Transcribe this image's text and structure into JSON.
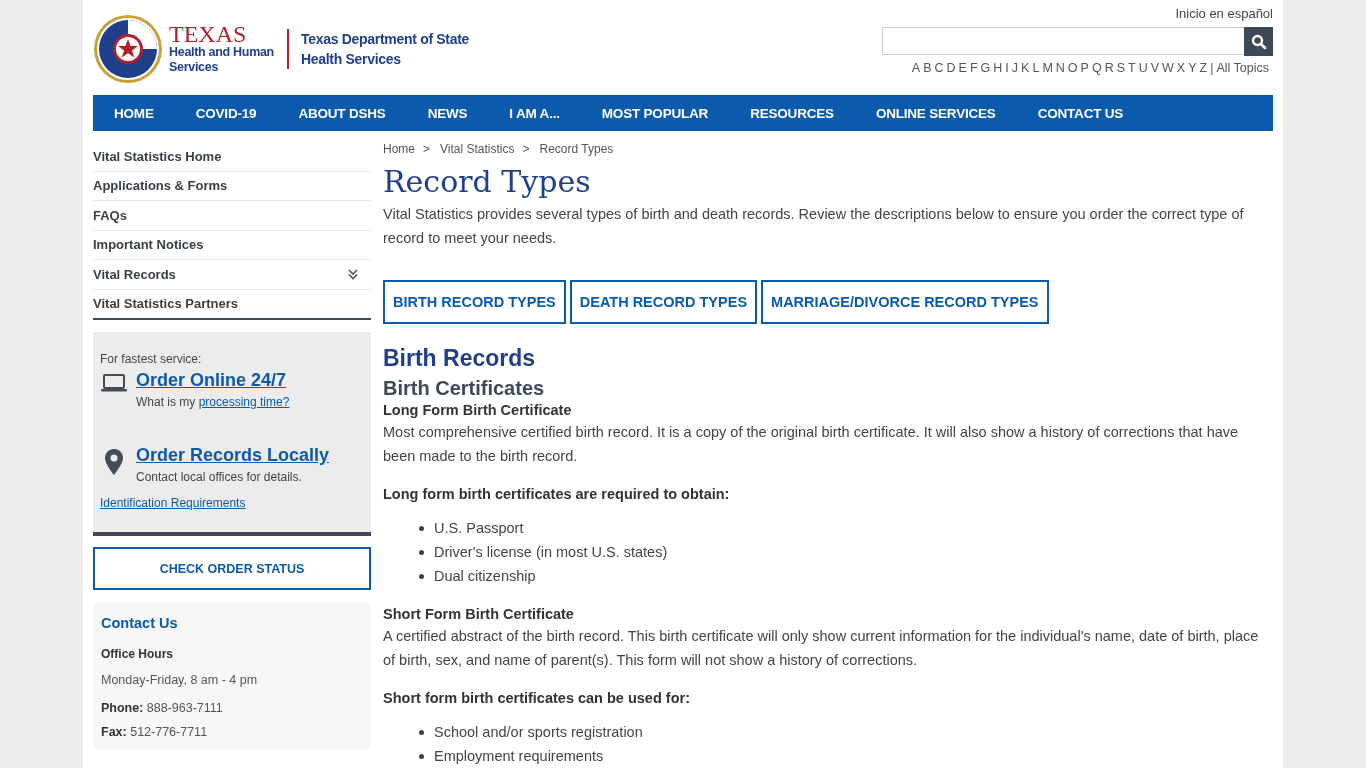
{
  "header": {
    "logo": {
      "agency": "TEXAS",
      "agency_sub": "Health and Human Services",
      "department": "Texas Department of State Health Services"
    },
    "lang_link": "Inicio en español",
    "az_letters": [
      "A",
      "B",
      "C",
      "D",
      "E",
      "F",
      "G",
      "H",
      "I",
      "J",
      "K",
      "L",
      "M",
      "N",
      "O",
      "P",
      "Q",
      "R",
      "S",
      "T",
      "U",
      "V",
      "W",
      "X",
      "Y",
      "Z"
    ],
    "az_separator": "|",
    "all_topics": "All Topics"
  },
  "nav": [
    "HOME",
    "COVID-19",
    "ABOUT DSHS",
    "NEWS",
    "I AM A...",
    "MOST POPULAR",
    "RESOURCES",
    "ONLINE SERVICES",
    "CONTACT US"
  ],
  "sidebar": {
    "items": [
      {
        "label": "Vital Statistics Home",
        "kind": "link"
      },
      {
        "label": "Applications & Forms",
        "kind": "link"
      },
      {
        "label": "FAQs",
        "kind": "link"
      },
      {
        "label": "Important Notices",
        "kind": "link"
      },
      {
        "label": "Vital Records",
        "kind": "submenu",
        "expanded": false
      },
      {
        "label": "Vital Statistics Partners",
        "kind": "link"
      }
    ],
    "order_box": {
      "intro": "For fastest service:",
      "online_link": "Order Online 24/7",
      "online_note": "What is my",
      "online_note_link": "processing time?",
      "local_link": "Order Records Locally",
      "local_note": "Contact local offices for details.",
      "id_link": "Identification Requirements"
    },
    "check_status_button": "CHECK ORDER STATUS",
    "contact": {
      "title": "Contact Us",
      "hours_label": "Office Hours",
      "hours": "Monday-Friday, 8 am - 4 pm",
      "phone_label": "Phone:",
      "phone": "888-963-7111",
      "fax_label": "Fax:",
      "fax": "512-776-7711"
    }
  },
  "main": {
    "breadcrumb": [
      "Home",
      "Vital Statistics",
      "Record Types"
    ],
    "breadcrumb_separator": ">",
    "title": "Record Types",
    "intro": "Vital Statistics provides several types of birth and death records. Review the descriptions below to ensure you order the correct type of record to meet your needs.",
    "jump_buttons": [
      "BIRTH RECORD TYPES",
      "DEATH RECORD TYPES",
      "MARRIAGE/DIVORCE RECORD TYPES"
    ],
    "section_title": "Birth Records",
    "subsection_title": "Birth Certificates",
    "blocks": [
      {
        "kind": "heading",
        "text": "Long Form Birth Certificate"
      },
      {
        "kind": "paragraph",
        "text": "Most comprehensive certified birth record. It is a copy of the original birth certificate. It will also show a history of corrections that have been made to the birth record."
      },
      {
        "kind": "lead",
        "text": "Long form birth certificates are required to obtain:"
      },
      {
        "kind": "list",
        "items": [
          "U.S. Passport",
          "Driver's license (in most U.S. states)",
          "Dual citizenship"
        ]
      },
      {
        "kind": "heading",
        "text": "Short Form Birth Certificate"
      },
      {
        "kind": "paragraph",
        "text": "A certified abstract of the birth record. This birth certificate will only show current information for the individual's name, date of birth, place of birth, sex, and name of parent(s). This form will not show a history of corrections."
      },
      {
        "kind": "lead",
        "text": "Short form birth certificates can be used for:"
      },
      {
        "kind": "list",
        "items": [
          "School and/or sports registration",
          "Employment requirements"
        ]
      }
    ]
  }
}
